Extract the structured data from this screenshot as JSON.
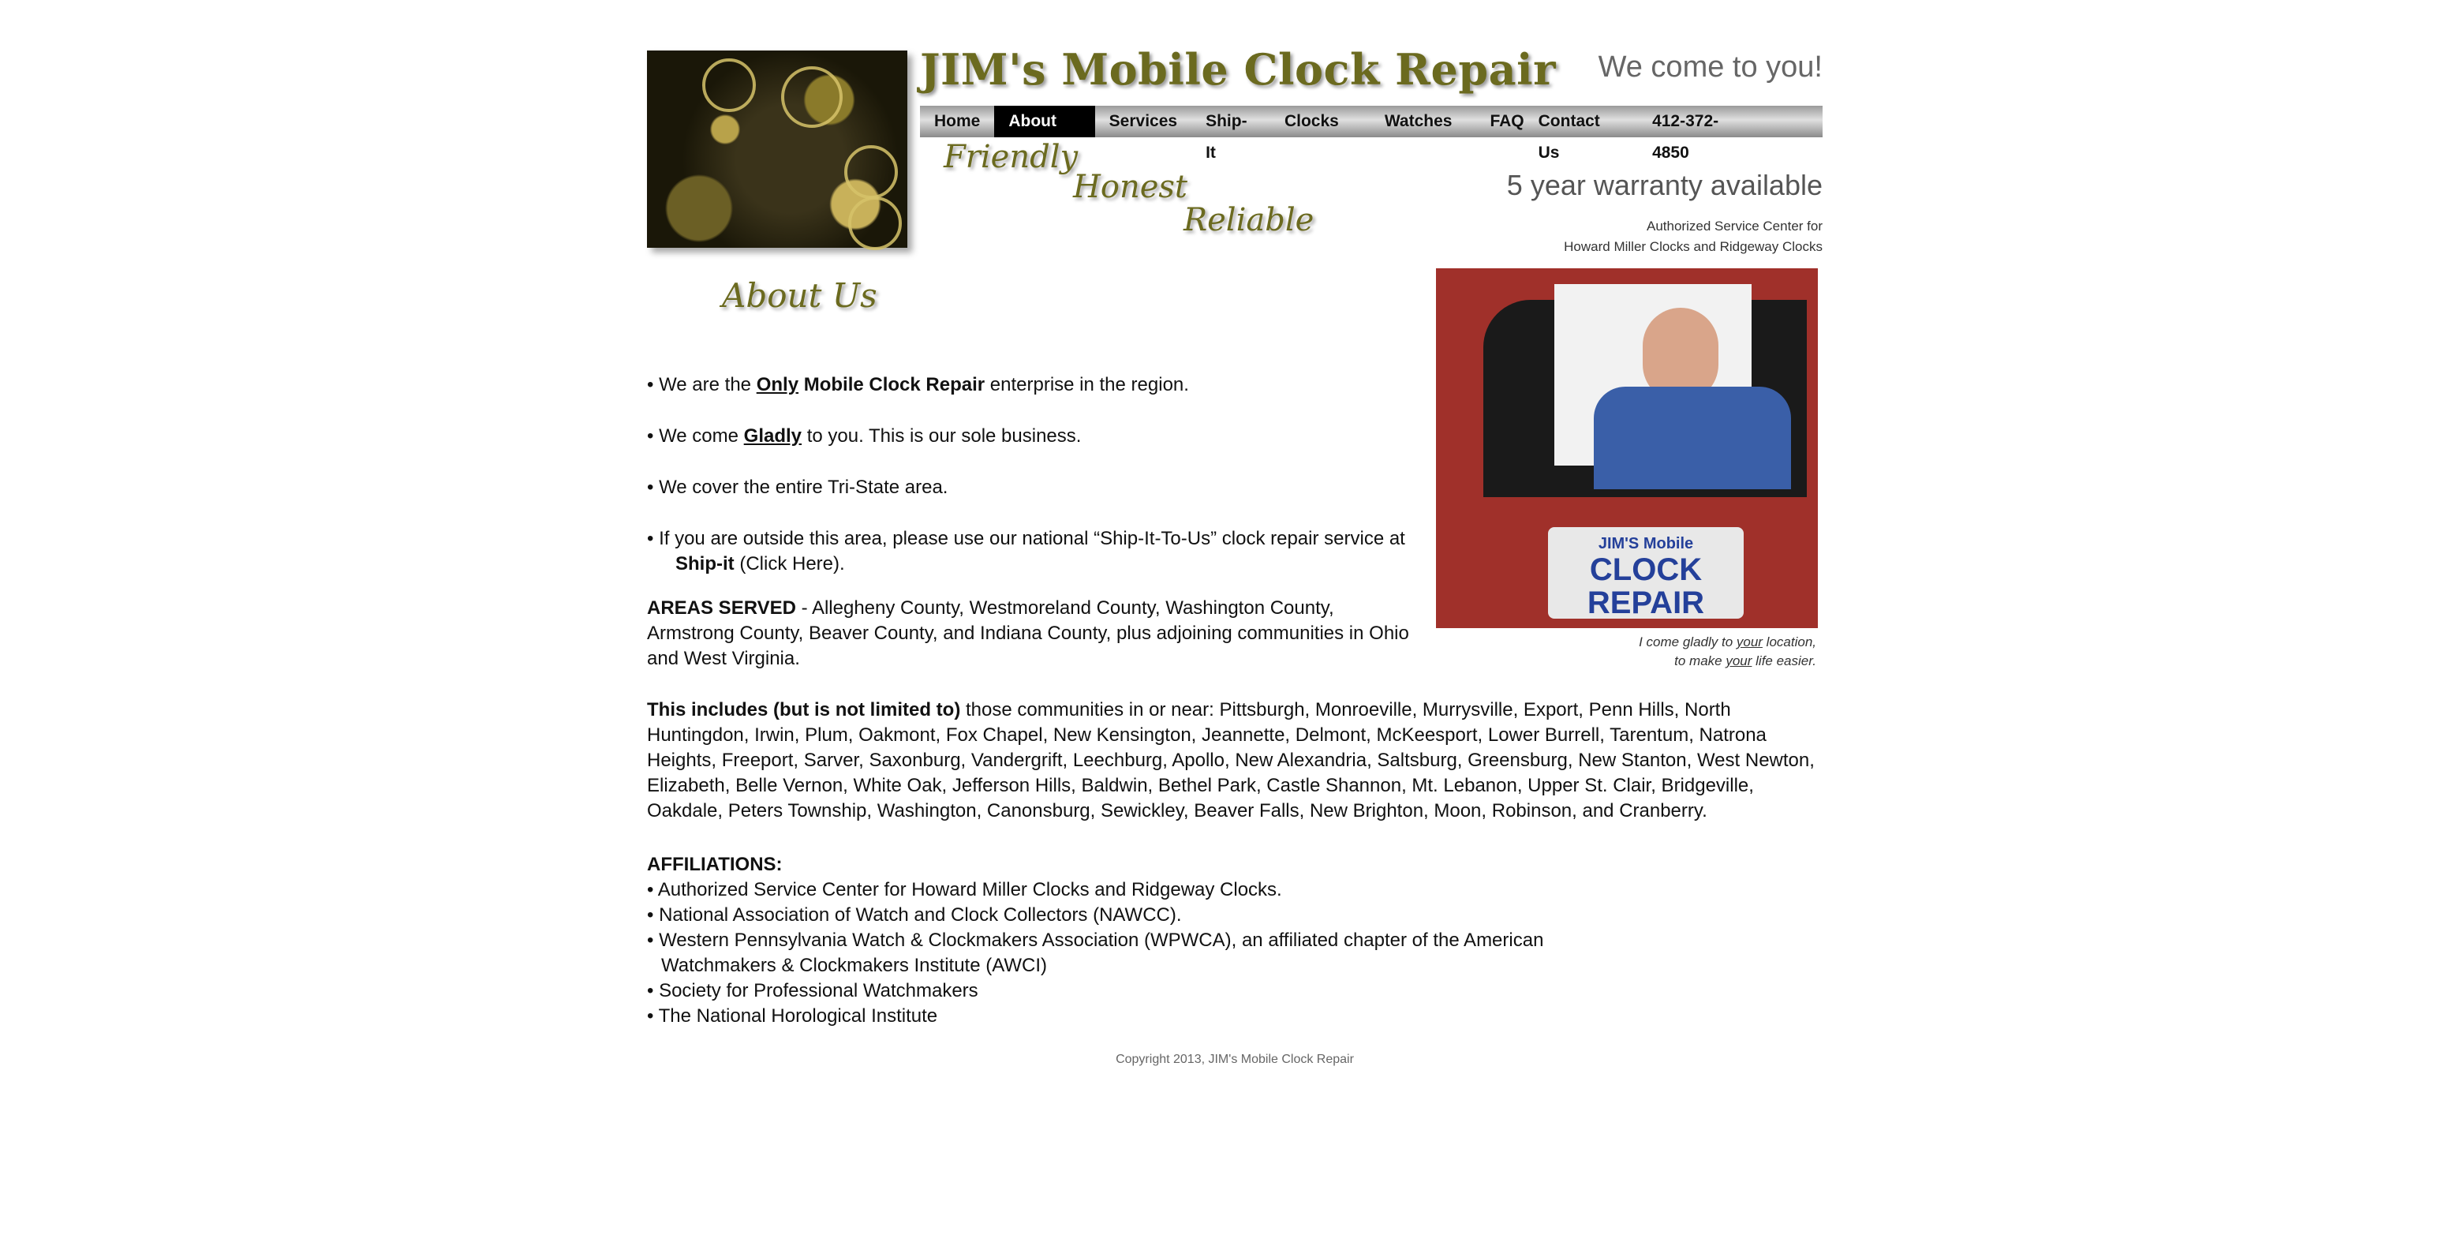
{
  "header": {
    "brand": "JIM's Mobile Clock Repair",
    "tagline": "We come to you!",
    "slogans": [
      "Friendly",
      "Honest",
      "Reliable"
    ],
    "warranty": "5 year warranty available",
    "authorized_line1": "Authorized Service Center for",
    "authorized_line2": "Howard Miller Clocks and Ridgeway Clocks"
  },
  "nav": {
    "items": [
      "Home",
      "About Us",
      "Services",
      "Ship-It",
      "Clocks",
      "Watches",
      "FAQ",
      "Contact Us"
    ],
    "active": "About Us",
    "phone": "412-372-4850"
  },
  "page_title": "About Us",
  "bullets": {
    "b1_pre": "• We are the ",
    "b1_only": "Only",
    "b1_bold": " Mobile Clock Repair",
    "b1_post": " enterprise in the region.",
    "b2_pre": "• We come ",
    "b2_gladly": "Gladly",
    "b2_post": " to you. This is our sole business.",
    "b3": "• We cover the entire Tri-State area.",
    "b4_line1": "• If you are outside this area, please use our national “Ship-It-To-Us” clock repair service at",
    "b4_shipit": "Ship-it",
    "b4_link": " (Click Here)."
  },
  "areas": {
    "label": "AREAS SERVED",
    "text": " - Allegheny County, Westmoreland County, Washington County, Armstrong County, Beaver County, and Indiana County, plus adjoining communities in Ohio and West Virginia."
  },
  "includes": {
    "label": "This includes (but is not limited to)",
    "text": " those communities in or near: Pittsburgh, Monroeville, Murrysville, Export, Penn Hills, North Huntingdon, Irwin, Plum, Oakmont, Fox Chapel, New Kensington, Jeannette, Delmont, McKeesport, Lower Burrell, Tarentum, Natrona Heights, Freeport, Sarver, Saxonburg, Vandergrift, Leechburg, Apollo, New Alexandria, Saltsburg, Greensburg, New Stanton, West Newton, Elizabeth, Belle Vernon, White Oak, Jefferson Hills, Baldwin, Bethel Park, Castle Shannon, Mt. Lebanon, Upper St. Clair, Bridgeville, Oakdale, Peters Township, Washington, Canonsburg, Sewickley, Beaver Falls, New Brighton, Moon, Robinson, and Cranberry."
  },
  "affiliations": {
    "label": "AFFILIATIONS:",
    "a1": "• Authorized Service Center for Howard Miller Clocks and Ridgeway Clocks.",
    "a2": "• National Association of Watch and Clock Collectors (NAWCC).",
    "a3_line1": "• Western Pennsylvania Watch & Clockmakers Association (WPWCA), an affiliated chapter of the American",
    "a3_line2": "Watchmakers & Clockmakers Institute (AWCI)",
    "a4": "• Society for Professional Watchmakers",
    "a5": "• The National Horological Institute"
  },
  "truck_sign": {
    "line1": "JIM'S Mobile",
    "line2": "CLOCK",
    "line3": "REPAIR"
  },
  "caption": {
    "line1_pre": "I come gladly to ",
    "line1_u": "your",
    "line1_post": " location,",
    "line2_pre": "to make ",
    "line2_u": "your",
    "line2_post": " life easier."
  },
  "footer": "Copyright 2013, JIM's Mobile Clock Repair"
}
